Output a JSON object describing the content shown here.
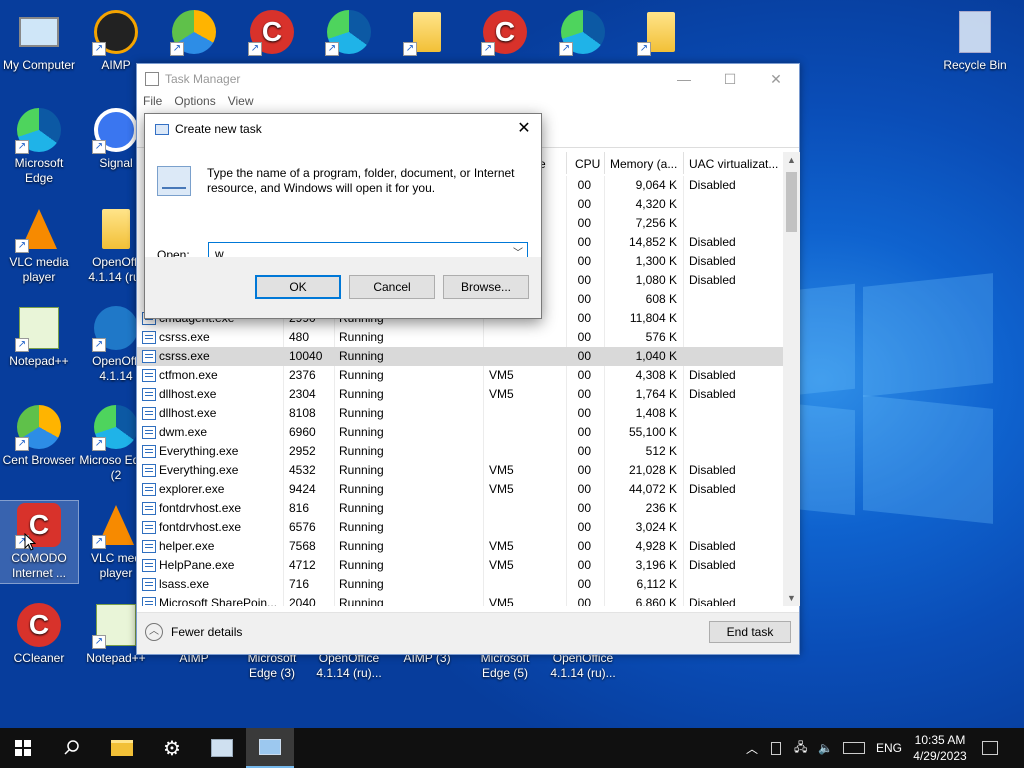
{
  "desktop": {
    "icons": [
      {
        "label": "My Computer"
      },
      {
        "label": "AIMP"
      },
      {
        "label": "Recycle Bin"
      },
      {
        "label": "Microsoft Edge"
      },
      {
        "label": "Signal"
      },
      {
        "label": "VLC media player"
      },
      {
        "label": "OpenOffi 4.1.14 (ru)"
      },
      {
        "label": "Notepad++"
      },
      {
        "label": "OpenOffi 4.1.14"
      },
      {
        "label": "Cent Browser"
      },
      {
        "label": "Microso Edge (2"
      },
      {
        "label": "COMODO Internet ..."
      },
      {
        "label": "VLC med player"
      },
      {
        "label": "CCleaner"
      },
      {
        "label": "Notepad++"
      },
      {
        "label": "AIMP"
      },
      {
        "label": "Microsoft Edge (3)"
      },
      {
        "label": "OpenOffice 4.1.14 (ru)..."
      },
      {
        "label": "AIMP (3)"
      },
      {
        "label": "Microsoft Edge (5)"
      },
      {
        "label": "OpenOffice 4.1.14 (ru)..."
      }
    ]
  },
  "task_manager": {
    "title": "Task Manager",
    "menu": [
      "File",
      "Options",
      "View"
    ],
    "columns": {
      "status_partial": "e",
      "cpu": "CPU",
      "memory": "Memory (a...",
      "uac": "UAC virtualizat..."
    },
    "rows": [
      {
        "name": "",
        "pid": "",
        "status": "",
        "user": "",
        "cpu": "00",
        "mem": "9,064 K",
        "uac": "Disabled"
      },
      {
        "name": "",
        "pid": "",
        "status": "",
        "user": "",
        "cpu": "00",
        "mem": "4,320 K",
        "uac": ""
      },
      {
        "name": "",
        "pid": "",
        "status": "",
        "user": "",
        "cpu": "00",
        "mem": "7,256 K",
        "uac": ""
      },
      {
        "name": "",
        "pid": "",
        "status": "",
        "user": "",
        "cpu": "00",
        "mem": "14,852 K",
        "uac": "Disabled"
      },
      {
        "name": "",
        "pid": "",
        "status": "",
        "user": "",
        "cpu": "00",
        "mem": "1,300 K",
        "uac": "Disabled"
      },
      {
        "name": "",
        "pid": "",
        "status": "",
        "user": "",
        "cpu": "00",
        "mem": "1,080 K",
        "uac": "Disabled"
      },
      {
        "name": "",
        "pid": "",
        "status": "",
        "user": "",
        "cpu": "00",
        "mem": "608 K",
        "uac": ""
      },
      {
        "name": "cmdagent.exe",
        "pid": "2990",
        "status": "Running",
        "user": "",
        "cpu": "00",
        "mem": "11,804 K",
        "uac": ""
      },
      {
        "name": "csrss.exe",
        "pid": "480",
        "status": "Running",
        "user": "",
        "cpu": "00",
        "mem": "576 K",
        "uac": ""
      },
      {
        "name": "csrss.exe",
        "pid": "10040",
        "status": "Running",
        "user": "",
        "cpu": "00",
        "mem": "1,040 K",
        "uac": "",
        "selected": true
      },
      {
        "name": "ctfmon.exe",
        "pid": "2376",
        "status": "Running",
        "user": "VM5",
        "cpu": "00",
        "mem": "4,308 K",
        "uac": "Disabled"
      },
      {
        "name": "dllhost.exe",
        "pid": "2304",
        "status": "Running",
        "user": "VM5",
        "cpu": "00",
        "mem": "1,764 K",
        "uac": "Disabled"
      },
      {
        "name": "dllhost.exe",
        "pid": "8108",
        "status": "Running",
        "user": "",
        "cpu": "00",
        "mem": "1,408 K",
        "uac": ""
      },
      {
        "name": "dwm.exe",
        "pid": "6960",
        "status": "Running",
        "user": "",
        "cpu": "00",
        "mem": "55,100 K",
        "uac": ""
      },
      {
        "name": "Everything.exe",
        "pid": "2952",
        "status": "Running",
        "user": "",
        "cpu": "00",
        "mem": "512 K",
        "uac": ""
      },
      {
        "name": "Everything.exe",
        "pid": "4532",
        "status": "Running",
        "user": "VM5",
        "cpu": "00",
        "mem": "21,028 K",
        "uac": "Disabled"
      },
      {
        "name": "explorer.exe",
        "pid": "9424",
        "status": "Running",
        "user": "VM5",
        "cpu": "00",
        "mem": "44,072 K",
        "uac": "Disabled"
      },
      {
        "name": "fontdrvhost.exe",
        "pid": "816",
        "status": "Running",
        "user": "",
        "cpu": "00",
        "mem": "236 K",
        "uac": ""
      },
      {
        "name": "fontdrvhost.exe",
        "pid": "6576",
        "status": "Running",
        "user": "",
        "cpu": "00",
        "mem": "3,024 K",
        "uac": ""
      },
      {
        "name": "helper.exe",
        "pid": "7568",
        "status": "Running",
        "user": "VM5",
        "cpu": "00",
        "mem": "4,928 K",
        "uac": "Disabled"
      },
      {
        "name": "HelpPane.exe",
        "pid": "4712",
        "status": "Running",
        "user": "VM5",
        "cpu": "00",
        "mem": "3,196 K",
        "uac": "Disabled"
      },
      {
        "name": "lsass.exe",
        "pid": "716",
        "status": "Running",
        "user": "",
        "cpu": "00",
        "mem": "6,112 K",
        "uac": ""
      },
      {
        "name": "Microsoft SharePoin...",
        "pid": "2040",
        "status": "Running",
        "user": "VM5",
        "cpu": "00",
        "mem": "6,860 K",
        "uac": "Disabled"
      }
    ],
    "fewer_details": "Fewer details",
    "end_task": "End task"
  },
  "run_dialog": {
    "title": "Create new task",
    "description": "Type the name of a program, folder, document, or Internet resource, and Windows will open it for you.",
    "open_label": "Open:",
    "input_value": "w",
    "ok": "OK",
    "cancel": "Cancel",
    "browse": "Browse..."
  },
  "taskbar": {
    "language": "ENG",
    "time": "10:35 AM",
    "date": "4/29/2023"
  },
  "colors": {
    "accent": "#0078d7",
    "desktop": "#0a4db7",
    "taskbar": "#101010"
  }
}
